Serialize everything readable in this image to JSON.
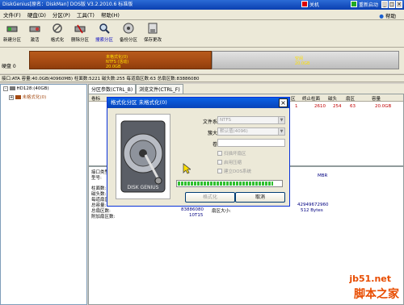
{
  "title": "DiskGenius[原名：DiskMan] DOS版 V3.2.2010.6 标准版",
  "titlebar_buttons": {
    "close_app": "关机",
    "restart": "重新启动"
  },
  "menu": [
    "文件(F)",
    "硬盘(D)",
    "分区(P)",
    "工具(T)",
    "帮助(H)"
  ],
  "help": "帮助",
  "toolbar": [
    "新建分区",
    "激活",
    "格式化",
    "删除分区",
    "搜索分区",
    "备份分区",
    "保存更改"
  ],
  "disk": {
    "label": "硬盘 0",
    "partition_text": [
      "未格式化(0)",
      "NTFS (活动)",
      "20.0GB"
    ],
    "free_text": [
      "空闲",
      "20.0GB"
    ]
  },
  "infobar": "接口:ATA  容量:40.0GB(40960MB)  柱面数:5221  磁头数:255  每道扇区数:63  总扇区数:83886080",
  "tree": {
    "disk": "HD128:(40GB)",
    "partition": "未格式化(0)"
  },
  "tabs": [
    "分区参数(CTRL_B)",
    "浏览文件(CTRL_F)"
  ],
  "table": {
    "headers": [
      "卷标",
      "区",
      "终止柱面",
      "磁头",
      "扇区",
      "容量"
    ],
    "row": [
      "1",
      "2610",
      "254",
      "63",
      "20.0GB"
    ]
  },
  "details": {
    "labels": [
      "接口类型:",
      "型号:",
      "柱面数:",
      "磁头数:",
      "每道扇区数:",
      "总容量:",
      "总扇区数:",
      "附加扇区数:"
    ],
    "total_sectors": "83886080",
    "extra_sectors": "10T15",
    "sector_size_label": "扇区大小:",
    "mbr": "MBR",
    "capacity_bytes": "42949672960",
    "sector_size": "512 Bytes"
  },
  "dialog": {
    "title": "格式化分区 未格式化(0)",
    "close": "×",
    "fs_label": "文件系统:",
    "fs_value": "NTFS",
    "cluster_label": "簇大小:",
    "cluster_value": "默认值(4096)",
    "volume_label": "卷标:",
    "volume_value": "",
    "checkboxes": [
      "扫描坏扇区",
      "启用压缩",
      "建立DOS系统"
    ],
    "progress": 0.92,
    "format_button": "格式化",
    "cancel_button": "取消",
    "disk_image_text": "DISK GENIUS"
  },
  "watermark": [
    "jb51.net",
    "脚本之家"
  ],
  "colors": {
    "partition": "#a44a12",
    "progress": "#2fbf2f",
    "title_blue": "#0a5fe0",
    "detail_value": "#000080",
    "table_value": "#c00000"
  }
}
